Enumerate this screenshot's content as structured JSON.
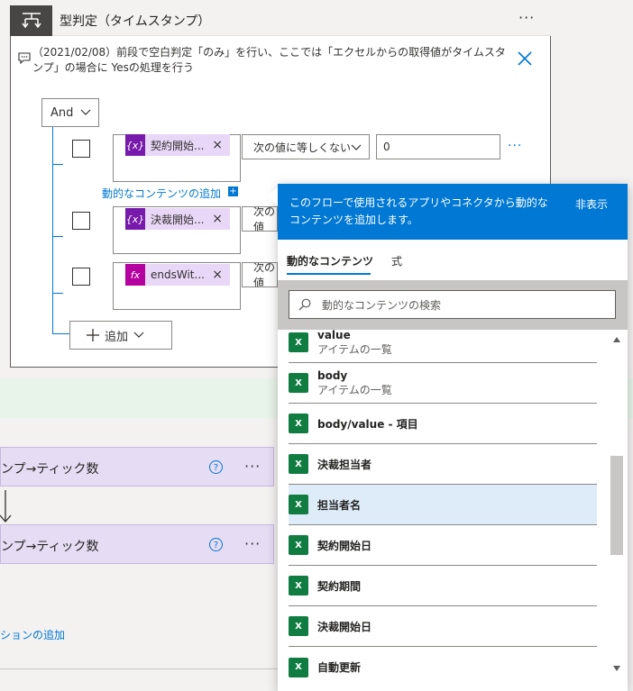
{
  "condition_card": {
    "title": "型判定（タイムスタンプ）",
    "more_label": "···",
    "comment": "（2021/02/08）前段で空白判定「のみ」を行い、ここでは「エクセルからの取得値がタイムスタンプ」の場合に Yesの処理を行う",
    "group_operator": "And",
    "rows": [
      {
        "token_icon": "{x}",
        "token_label": "契約開始...",
        "remove": "×",
        "operator": "次の値に等しくない",
        "value": "0",
        "more": "···"
      },
      {
        "token_icon": "{x}",
        "token_label": "決裁開始...",
        "remove": "×",
        "operator": "次の値"
      },
      {
        "token_icon": "fx",
        "token_label": "endsWit...",
        "remove": "×",
        "operator": "次の値"
      }
    ],
    "add_dynamic_label": "動的なコンテンツの追加",
    "add_dynamic_plus": "+",
    "add_label": "追加"
  },
  "background": {
    "card1_title": "ンプ→ティック数",
    "card2_title": "ンプ→ティック数",
    "help": "?",
    "more": "···",
    "action_link": "ションの追加"
  },
  "dynamic_panel": {
    "header_text": "このフローで使用されるアプリやコネクタから動的なコンテンツを追加します。",
    "hide_label": "非表示",
    "tabs": [
      "動的なコンテンツ",
      "式"
    ],
    "search_placeholder": "動的なコンテンツの検索",
    "items": [
      {
        "title": "value",
        "subtitle": "アイテムの一覧"
      },
      {
        "title": "body",
        "subtitle": "アイテムの一覧"
      },
      {
        "title": "body/value - 項目",
        "subtitle": ""
      },
      {
        "title": "決裁担当者",
        "subtitle": ""
      },
      {
        "title": "担当者名",
        "subtitle": "",
        "highlighted": true
      },
      {
        "title": "契約開始日",
        "subtitle": ""
      },
      {
        "title": "契約期間",
        "subtitle": ""
      },
      {
        "title": "決裁開始日",
        "subtitle": ""
      },
      {
        "title": "自動更新",
        "subtitle": ""
      }
    ],
    "excel_icon_glyph": "X"
  },
  "colors": {
    "accent": "#0078d4",
    "token": "#e9d7f7",
    "variable": "#7719aa",
    "expression": "#b4009e",
    "excel": "#107c41",
    "highlight": "#deecf9"
  }
}
